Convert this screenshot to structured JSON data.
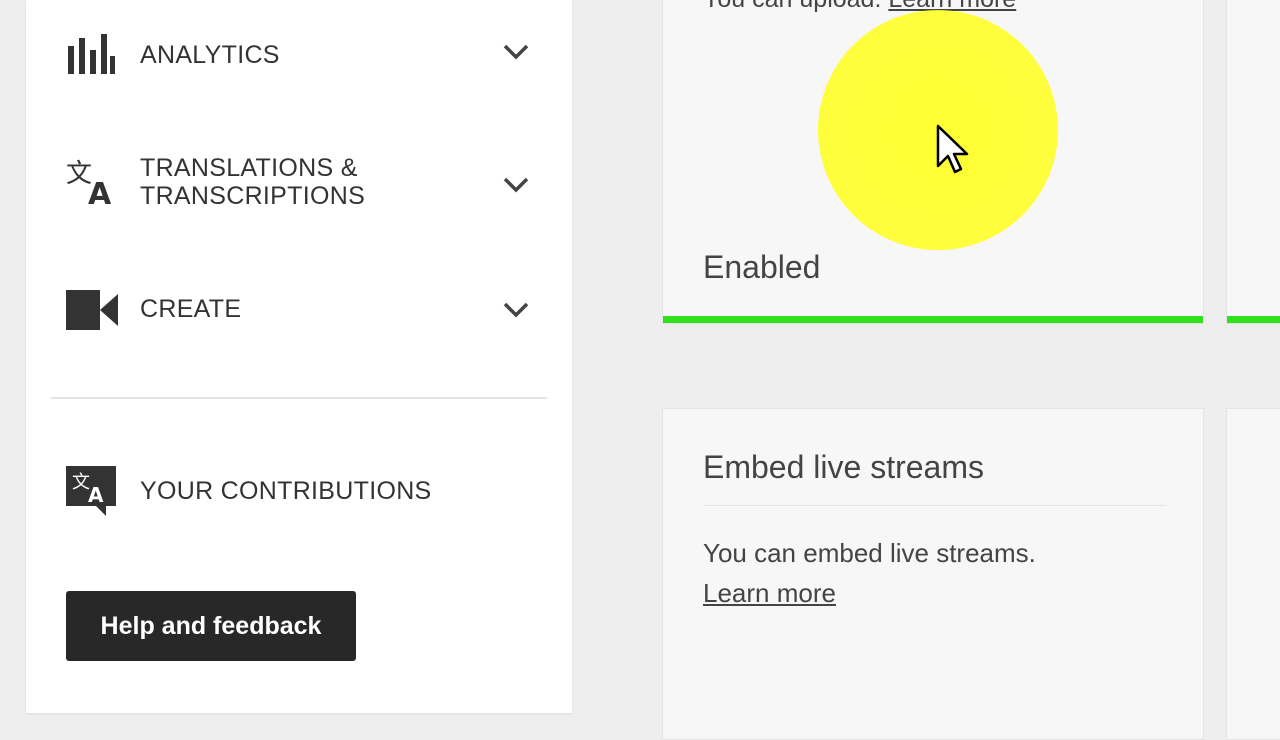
{
  "sidebar": {
    "items": [
      {
        "label": "ANALYTICS",
        "icon": "bar-chart-icon"
      },
      {
        "label": "TRANSLATIONS &\nTRANSCRIPTIONS",
        "icon": "translate-icon"
      },
      {
        "label": "CREATE",
        "icon": "video-camera-icon"
      },
      {
        "label": "YOUR CONTRIBUTIONS",
        "icon": "translate-bubble-icon"
      }
    ],
    "help_button": "Help and feedback"
  },
  "cards": {
    "upload": {
      "top_text": "You can upload.",
      "link": "Learn more",
      "status": "Enabled",
      "status_color": "#30e01d"
    },
    "embed": {
      "title": "Embed live streams",
      "desc": "You can embed live streams.",
      "link": "Learn more"
    }
  },
  "colors": {
    "background": "#eeeeee",
    "sidebar": "#ffffff",
    "button": "#282828",
    "highlight": "#ffff28"
  }
}
